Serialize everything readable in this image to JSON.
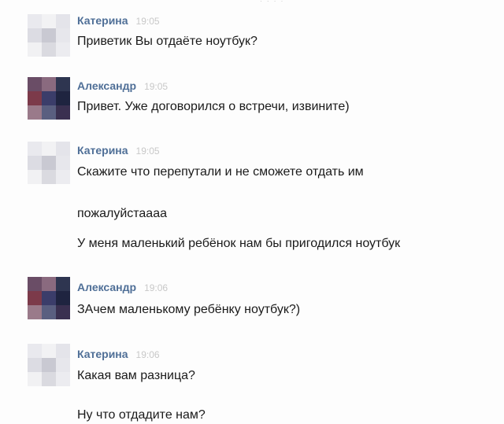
{
  "header": {
    "fragment": "· · · ·"
  },
  "groups": [
    {
      "sender": "Катерина",
      "time": "19:05",
      "avatar": "kat",
      "messages": [
        "Приветик Вы отдаёте ноутбук?"
      ]
    },
    {
      "sender": "Александр",
      "time": "19:05",
      "avatar": "alex",
      "messages": [
        "Привет. Уже договорился о встречи, извините)"
      ]
    },
    {
      "sender": "Катерина",
      "time": "19:05",
      "avatar": "kat",
      "messages": [
        "Скажите что перепутали и не сможете отдать им",
        "пожалуйстаааа",
        "У меня маленький ребёнок нам бы пригодился ноутбук"
      ]
    },
    {
      "sender": "Александр",
      "time": "19:06",
      "avatar": "alex",
      "messages": [
        "ЗАчем маленькому ребёнку ноутбук?)"
      ]
    },
    {
      "sender": "Катерина",
      "time": "19:06",
      "avatar": "kat",
      "messages": [
        "Какая вам разница?",
        "Ну что отдадите нам?"
      ]
    }
  ],
  "avatar_colors": {
    "kat": [
      "#e9e9ee",
      "#f2f2f4",
      "#e4e4ea",
      "#dcdce3",
      "#c9c9d2",
      "#e7e7ec",
      "#f1f1f3",
      "#dadae0",
      "#ececf0"
    ],
    "alex": [
      "#6a4d66",
      "#8a6a7f",
      "#2e3550",
      "#7c3a4a",
      "#3b3d6a",
      "#1f2440",
      "#9a7a8a",
      "#5a5f80",
      "#3a3050"
    ]
  }
}
